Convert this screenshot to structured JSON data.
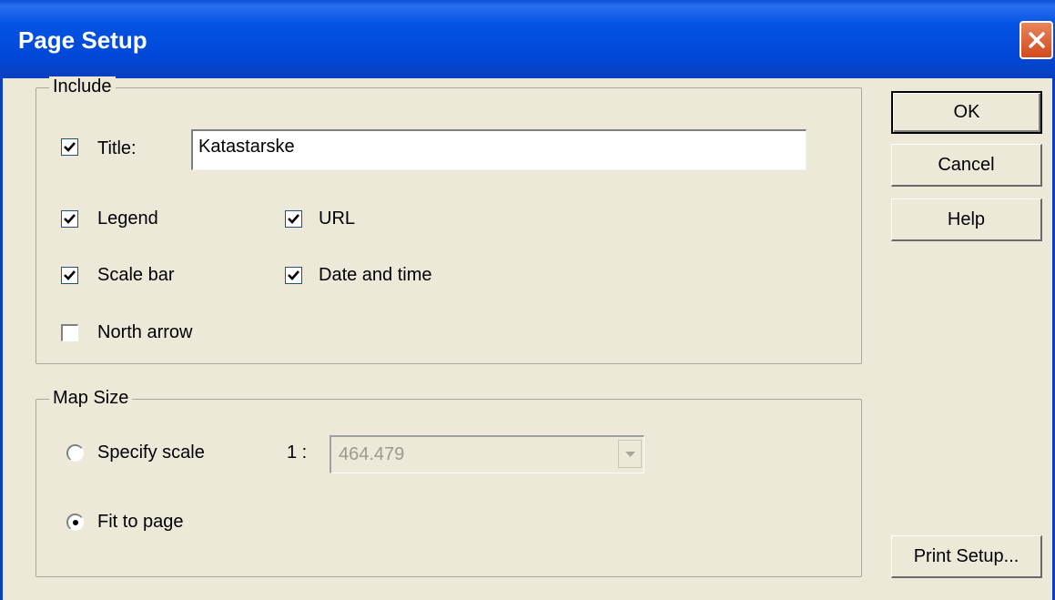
{
  "window": {
    "title": "Page Setup"
  },
  "include": {
    "legend": "Include",
    "title_label": "Title:",
    "title_value": "Katastarske",
    "legend_label": "Legend",
    "url_label": "URL",
    "scale_bar_label": "Scale bar",
    "date_time_label": "Date and time",
    "north_arrow_label": "North arrow",
    "checked": {
      "title": true,
      "legend": true,
      "url": true,
      "scale_bar": true,
      "date_time": true,
      "north_arrow": false
    }
  },
  "map_size": {
    "legend": "Map Size",
    "specify_scale_label": "Specify scale",
    "ratio_label": "1 :",
    "scale_value": "464.479",
    "fit_to_page_label": "Fit to page",
    "selected": "fit_to_page"
  },
  "buttons": {
    "ok": "OK",
    "cancel": "Cancel",
    "help": "Help",
    "print_setup": "Print Setup..."
  },
  "icons": {
    "close": "close-icon",
    "check": "checkmark-icon",
    "dropdown": "chevron-down-icon"
  },
  "colors": {
    "titlebar": "#0454e4",
    "dialog_bg": "#ece9d8",
    "close_button": "#d24a1e"
  }
}
